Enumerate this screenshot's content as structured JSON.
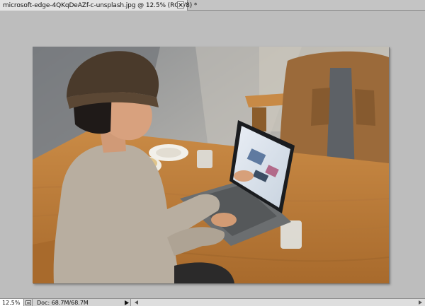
{
  "document": {
    "tab_title": "microsoft-edge-4QKqDeAZf-c-unsplash.jpg @ 12.5% (RGB/8) *",
    "close_symbol": "×"
  },
  "statusbar": {
    "zoom": "12.5%",
    "doc_info": "Doc: 68.7M/68.7M"
  },
  "icons": {
    "close": "close-icon",
    "status": "document-status-icon",
    "menu_arrow": "triangle-right-icon",
    "scroll_left": "scroll-left-arrow-icon",
    "scroll_right": "scroll-right-arrow-icon"
  },
  "colors": {
    "workspace": "#bdbdbd",
    "tab_active": "#e4e4e4",
    "statusbar": "#d4d4d4"
  }
}
